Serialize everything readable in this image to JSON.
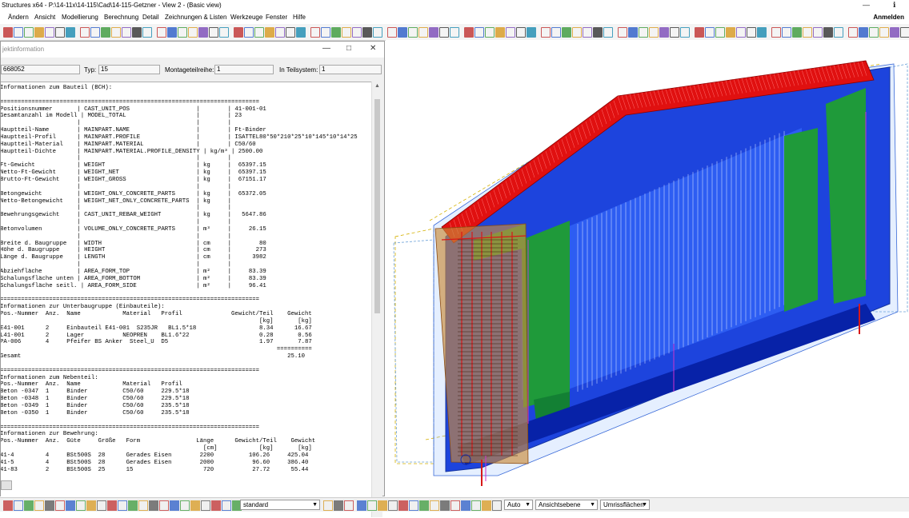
{
  "titlebar": {
    "title": "Structures x64 - P:\\14-11x\\14-115\\Cad\\14-115-Getzner - View 2 - (Basic view)"
  },
  "menu": {
    "items": [
      "Ändern",
      "Ansicht",
      "Modellierung",
      "Berechnung",
      "Detail",
      "Zeichnungen & Listen",
      "Werkzeuge",
      "Fenster",
      "Hilfe"
    ],
    "signin": "Anmelden"
  },
  "dialog": {
    "title": "jektinformation",
    "fields": {
      "id": "668052",
      "typ_label": "Typ:",
      "typ": "15",
      "montage_label": "Montageteilreihe:",
      "montage": "1",
      "teilsystem_label": "In Teilsystem:",
      "teilsystem": "1"
    },
    "report_lines": [
      "Informationen zum Bauteil (BCH):",
      "",
      "==========================================================================",
      "Positionsnummer       | CAST_UNIT_POS                   |        | 41-001-01",
      "Gesamtanzahl im Modell | MODEL_TOTAL                    |        | 23",
      "                      |                                 |        |",
      "Hauptteil-Name        | MAINPART.NAME                   |        | Ft-Binder",
      "Hauptteil-Profil      | MAINPART.PROFILE                |        | ISATTEL80*50*210*25*10*145*10*14*25",
      "Hauptteil-Material    | MAINPART.MATERIAL               |        | C50/60",
      "Hauptteil-Dichte      | MAINPART.MATERIAL.PROFILE_DENSITY | kg/m³ | 2500.00",
      "                      |                                 |        |",
      "Ft-Gewicht            | WEIGHT                          | kg     |  65397.15",
      "Netto-Ft-Gewicht      | WEIGHT_NET                      | kg     |  65397.15",
      "Brutto-Ft-Gewicht     | WEIGHT_GROSS                    | kg     |  67151.17",
      "                      |                                 |        |",
      "Betongewicht          | WEIGHT_ONLY_CONCRETE_PARTS      | kg     |  65372.05",
      "Netto-Betongewicht    | WEIGHT_NET_ONLY_CONCRETE_PARTS  | kg     |",
      "                      |                                 |        |",
      "Bewehrungsgewicht     | CAST_UNIT_REBAR_WEIGHT          | kg     |   5647.86",
      "                      |                                 |        |",
      "Betonvolumen          | VOLUME_ONLY_CONCRETE_PARTS      | m³     |     26.15",
      "                      |                                 |        |",
      "Breite d. Baugruppe   | WIDTH                           | cm     |        80",
      "Höhe d. Baugruppe     | HEIGHT                          | cm     |       273",
      "Länge d. Baugruppe    | LENGTH                          | cm     |      3982",
      "                      |                                 |        |",
      "Abziehfläche          | AREA_FORM_TOP                   | m²     |     83.39",
      "Schalungsfläche unten | AREA_FORM_BOTTOM                | m²     |     83.39",
      "Schalungsfläche seitl. | AREA_FORM_SIDE                 | m²     |     96.41",
      "",
      "==========================================================================",
      "Informationen zur Unterbaugruppe (Einbauteile):",
      "Pos.-Nummer  Anz.  Name            Material   Profil              Gewicht/Teil    Gewicht",
      "                                                                          [kg]       [kg]",
      "E41-001      2     Einbauteil E41-001  S235JR   BL1.5*18                  8.34      16.67",
      "L41-001      2     Lager           NEOPREN    BL1.6*22                    0.28       0.56",
      "PA-006       4     Pfeifer BS Anker  Steel_U  D5                          1.97       7.87",
      "                                                                               ==========",
      "Gesamt                                                                            25.10",
      "",
      "==========================================================================",
      "Informationen zum Nebenteil:",
      "Pos.-Nummer  Anz.  Name            Material   Profil",
      "Beton -0347  1     Binder          C50/60     229.5*18",
      "Beton -0348  1     Binder          C50/60     229.5*18",
      "Beton -0349  1     Binder          C50/60     235.5*18",
      "Beton -0350  1     Binder          C50/60     235.5*18",
      "",
      "==========================================================================",
      "Informationen zur Bewehrung:",
      "Pos.-Nummer  Anz.  Güte     Größe   Form                Länge      Gewicht/Teil    Gewicht",
      "                                                          [cm]            [kg]       [kg]",
      "41-4         4     BSt500S  28      Gerades Eisen        2200          106.26     425.04",
      "41-5         4     BSt500S  28      Gerades Eisen        2000           96.60     386.40",
      "41-83        2     BSt500S  25      15                    720           27.72      55.44"
    ]
  },
  "statusbar": {
    "standard": "standard",
    "auto": "Auto",
    "plane": "Ansichtsebene",
    "outline": "Umrissflächen"
  }
}
